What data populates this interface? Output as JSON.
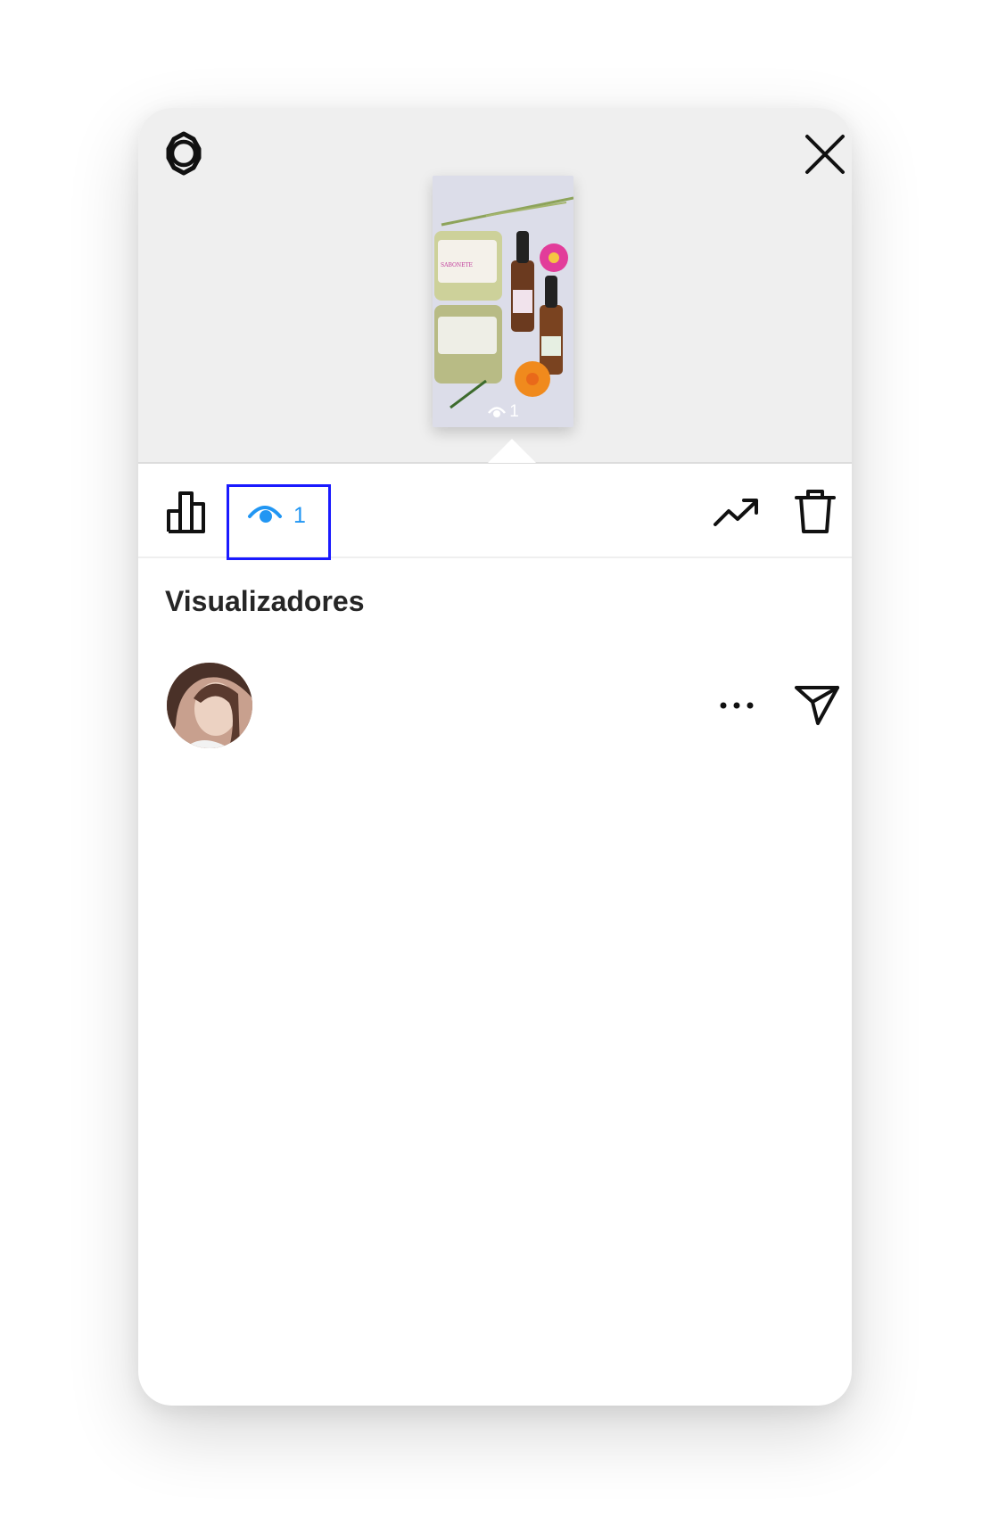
{
  "header": {
    "settings_icon": "gear-icon",
    "close_icon": "close-icon"
  },
  "story_preview": {
    "view_count": "1",
    "view_icon": "eye-icon"
  },
  "toolbar": {
    "insights_icon": "bar-chart-icon",
    "viewers_icon": "eye-icon",
    "viewers_count": "1",
    "promote_icon": "trending-up-icon",
    "delete_icon": "trash-icon",
    "accent_color": "#2196f3",
    "highlight_color": "#1a1aff"
  },
  "viewers": {
    "title": "Visualizadores",
    "items": [
      {
        "avatar_icon": "avatar",
        "more_icon": "more-dots-icon",
        "share_icon": "send-icon"
      }
    ]
  }
}
